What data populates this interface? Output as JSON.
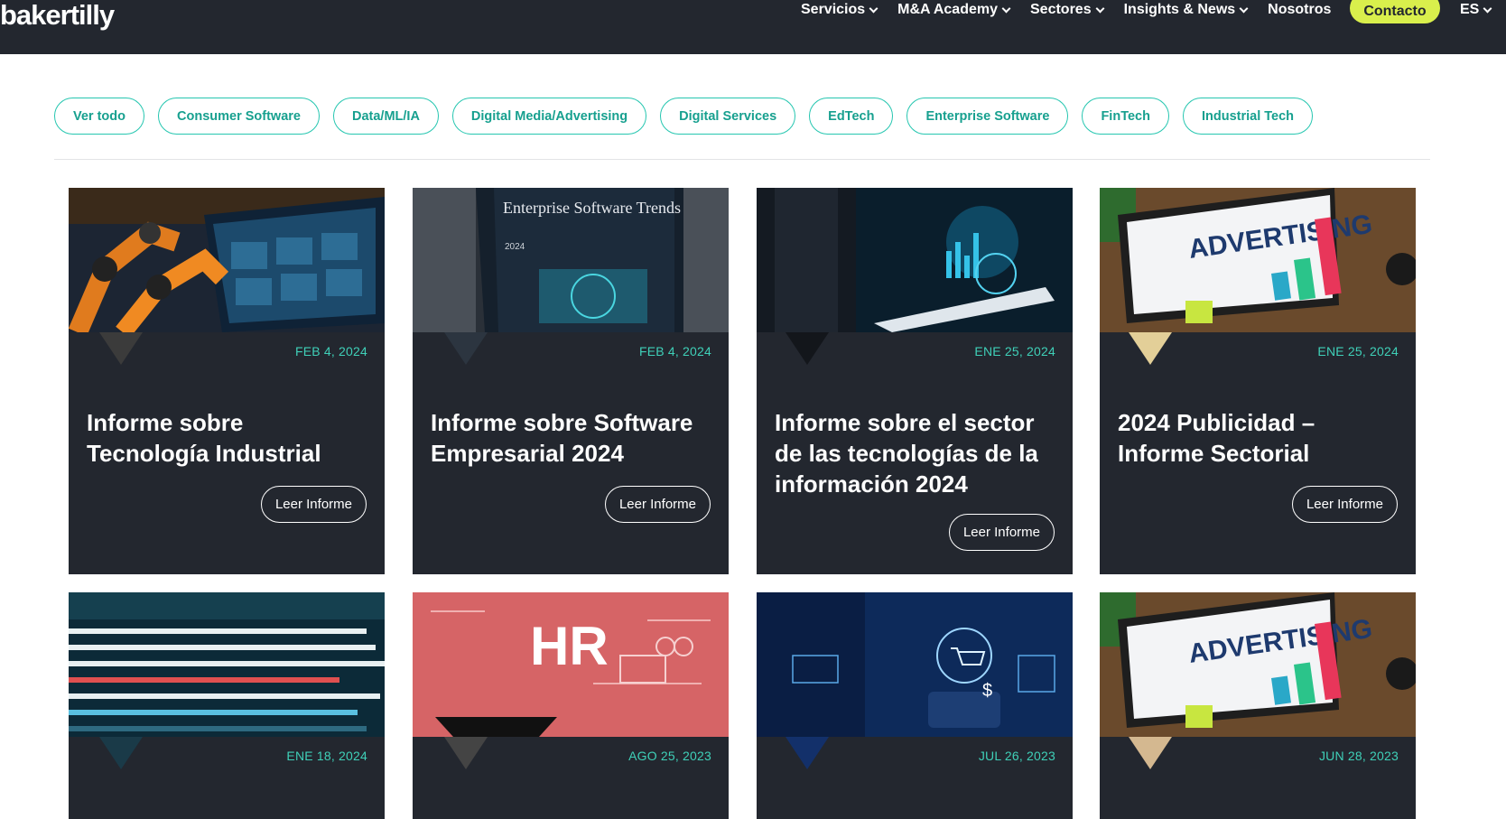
{
  "header": {
    "logo": "bakertilly",
    "nav": [
      {
        "label": "Servicios",
        "dropdown": true
      },
      {
        "label": "M&A Academy",
        "dropdown": true
      },
      {
        "label": "Sectores",
        "dropdown": true
      },
      {
        "label": "Insights & News",
        "dropdown": true
      },
      {
        "label": "Nosotros",
        "dropdown": false
      }
    ],
    "contact_label": "Contacto",
    "language": "ES"
  },
  "filters": [
    "Ver todo",
    "Consumer Software",
    "Data/ML/IA",
    "Digital Media/Advertising",
    "Digital Services",
    "EdTech",
    "Enterprise Software",
    "FinTech",
    "Industrial Tech"
  ],
  "cards": [
    {
      "date": "FEB 4, 2024",
      "title": "Informe sobre Tecnología Industrial",
      "button": "Leer Informe",
      "image": "industrial-robot-image"
    },
    {
      "date": "FEB 4, 2024",
      "title": "Informe sobre Software Empresarial 2024",
      "button": "Leer Informe",
      "image": "enterprise-software-book-image",
      "image_title": "Enterprise Software Trends",
      "image_year": "2024"
    },
    {
      "date": "ENE 25, 2024",
      "title": "Informe sobre el sector de las tecnologías de la información 2024",
      "button": "Leer Informe",
      "image": "tablet-data-image"
    },
    {
      "date": "ENE 25, 2024",
      "title": "2024 Publicidad – Informe Sectorial",
      "button": "Leer Informe",
      "image": "advertising-monitor-image",
      "image_text": "ADVERTISING"
    },
    {
      "date": "ENE 18, 2024",
      "title": "",
      "button": "",
      "image": "code-screen-image"
    },
    {
      "date": "AGO 25, 2023",
      "title": "",
      "button": "",
      "image": "hr-circuit-image",
      "image_text": "HR"
    },
    {
      "date": "JUL 26, 2023",
      "title": "",
      "button": "",
      "image": "ecommerce-hologram-image"
    },
    {
      "date": "JUN 28, 2023",
      "title": "",
      "button": "",
      "image": "advertising-monitor-image",
      "image_text": "ADVERTISING"
    }
  ],
  "colors": {
    "header_bg": "#23272f",
    "card_bg": "#23272f",
    "accent_teal": "#26c6b0",
    "date_teal": "#3fd0b8",
    "contact_lime": "#d9ef4c"
  }
}
